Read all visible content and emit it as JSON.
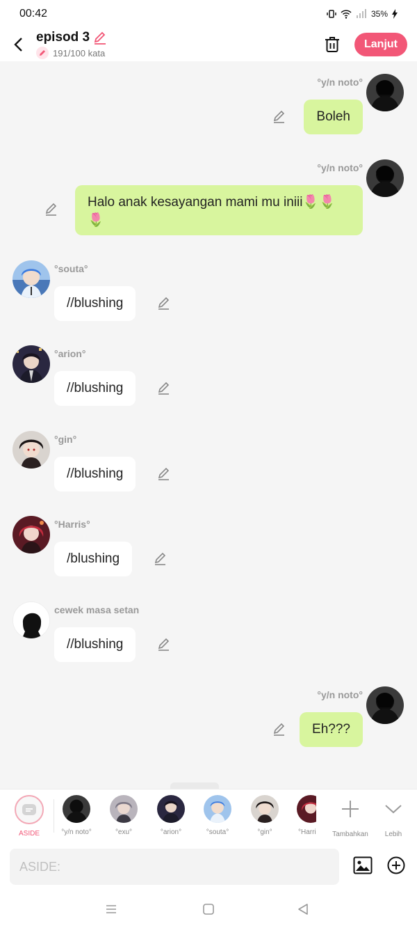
{
  "status": {
    "time": "00:42",
    "battery": "35%"
  },
  "header": {
    "title": "episod 3",
    "word_count": "191/100 kata",
    "next_label": "Lanjut"
  },
  "messages": [
    {
      "side": "right",
      "name": "°y/n noto°",
      "text": "Boleh"
    },
    {
      "side": "right",
      "name": "°y/n noto°",
      "text": "Halo anak kesayangan mami mu iniii🌷🌷🌷"
    },
    {
      "side": "left",
      "name": "°souta°",
      "text": "//blushing"
    },
    {
      "side": "left",
      "name": "°arion°",
      "text": "//blushing"
    },
    {
      "side": "left",
      "name": "°gin°",
      "text": "//blushing"
    },
    {
      "side": "left",
      "name": "°Harris°",
      "text": "/blushing"
    },
    {
      "side": "left",
      "name": "cewek masa setan",
      "text": "//blushing"
    },
    {
      "side": "right",
      "name": "°y/n noto°",
      "text": "Eh???"
    }
  ],
  "characters": {
    "aside": "ASIDE",
    "items": [
      "°y/n noto°",
      "°exu°",
      "°arion°",
      "°souta°",
      "°gin°",
      "°Harris°"
    ],
    "add": "Tambahkan",
    "more": "Lebih"
  },
  "input": {
    "placeholder": "ASIDE:"
  },
  "colors": {
    "accent": "#f25777",
    "green_bubble": "#d8f59e"
  }
}
